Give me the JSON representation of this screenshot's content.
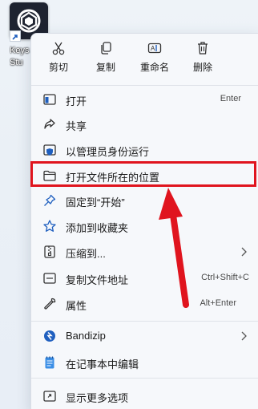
{
  "desktop": {
    "icon_name": "app-logo-icon",
    "label": "Keys\nStu"
  },
  "toolbar": [
    {
      "name": "cut",
      "label": "剪切",
      "icon": "scissors-icon"
    },
    {
      "name": "copy",
      "label": "复制",
      "icon": "copy-icon"
    },
    {
      "name": "rename",
      "label": "重命名",
      "icon": "rename-icon"
    },
    {
      "name": "delete",
      "label": "删除",
      "icon": "trash-icon"
    }
  ],
  "menu": {
    "open": {
      "label": "打开",
      "shortcut": "Enter",
      "icon": "open-window-icon"
    },
    "share": {
      "label": "共享",
      "icon": "share-icon"
    },
    "run_admin": {
      "label": "以管理员身份运行",
      "icon": "shield-icon"
    },
    "open_location": {
      "label": "打开文件所在的位置",
      "icon": "folder-icon"
    },
    "pin_start": {
      "label": "固定到“开始”",
      "icon": "pin-icon"
    },
    "favorites": {
      "label": "添加到收藏夹",
      "icon": "star-icon"
    },
    "compress": {
      "label": "压缩到...",
      "icon": "zip-icon"
    },
    "copy_path": {
      "label": "复制文件地址",
      "shortcut": "Ctrl+Shift+C",
      "icon": "copy-path-icon"
    },
    "properties": {
      "label": "属性",
      "shortcut": "Alt+Enter",
      "icon": "wrench-icon"
    },
    "bandizip": {
      "label": "Bandizip",
      "icon": "bandizip-icon"
    },
    "notepad": {
      "label": "在记事本中编辑",
      "icon": "notepad-icon"
    },
    "more": {
      "label": "显示更多选项",
      "icon": "more-options-icon"
    }
  },
  "colors": {
    "highlight": "#e0141e",
    "accent": "#1f5fbf"
  }
}
